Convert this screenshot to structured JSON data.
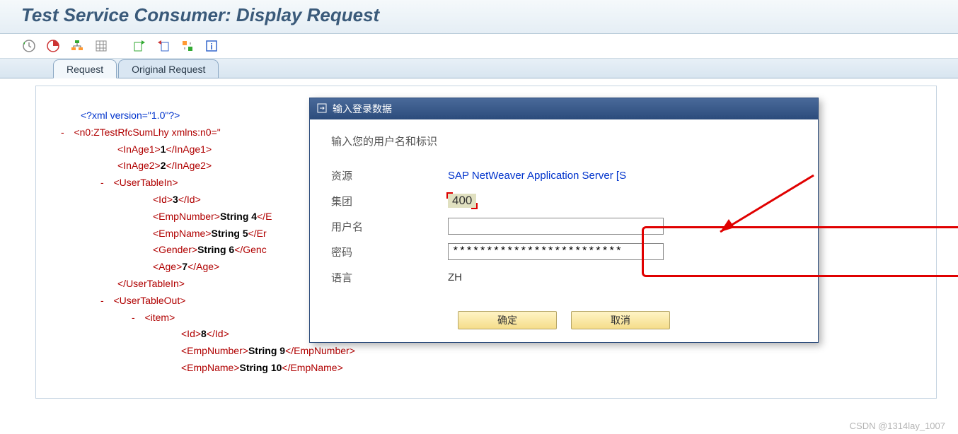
{
  "header": {
    "title": "Test Service Consumer: Display Request"
  },
  "tabs": {
    "request": "Request",
    "original": "Original Request"
  },
  "xml": {
    "decl": "<?xml version=\"1.0\"?>",
    "root_open": "<n0:ZTestRfcSumLhy",
    "root_attr": " xmlns:n0=\"",
    "inage1_open": "<InAge1>",
    "inage1_val": "1",
    "inage1_close": "</InAge1>",
    "inage2_open": "<InAge2>",
    "inage2_val": "2",
    "inage2_close": "</InAge2>",
    "uti_open": "<UserTableIn>",
    "id_open": "<Id>",
    "id_val": "3",
    "id_close": "</Id>",
    "en_open": "<EmpNumber>",
    "en_val": "String 4",
    "en_close_trunc": "</E",
    "enm_open": "<EmpName>",
    "enm_val": "String 5",
    "enm_close_trunc": "</Er",
    "g_open": "<Gender>",
    "g_val": "String 6",
    "g_close_trunc": "</Genc",
    "age_open": "<Age>",
    "age_val": "7",
    "age_close": "</Age>",
    "uti_close": "</UserTableIn>",
    "uto_open": "<UserTableOut>",
    "item_open": "<item>",
    "id2_open": "<Id>",
    "id2_val": "8",
    "id2_close": "</Id>",
    "en2_open": "<EmpNumber>",
    "en2_val": "String 9",
    "en2_close": "</EmpNumber>",
    "enm2_open": "<EmpName>",
    "enm2_val": "String 10",
    "enm2_close": "</EmpName>",
    "dash": "-"
  },
  "dialog": {
    "title": "输入登录数据",
    "intro": "输入您的用户名和标识",
    "resource_label": "资源",
    "resource_value": "SAP NetWeaver Application Server [S",
    "client_label": "集团",
    "client_value": "400",
    "user_label": "用户名",
    "user_value": "",
    "pass_label": "密码",
    "pass_value": "*************************",
    "lang_label": "语言",
    "lang_value": "ZH",
    "ok": "确定",
    "cancel": "取消"
  },
  "watermark": "CSDN @1314lay_1007"
}
